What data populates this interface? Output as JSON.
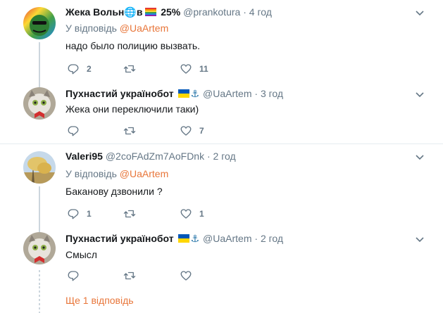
{
  "tweets": [
    {
      "name": "Жека Вольн",
      "name_suffix": "в",
      "name_extra": "25%",
      "handle": "@prankotura",
      "time": "4 год",
      "reply_prefix": "У відповідь",
      "reply_mention": "@UaArtem",
      "text": "надо было полицию вызвать.",
      "replies": "2",
      "retweets": "",
      "likes": "11"
    },
    {
      "name": "Пухнастий українобот",
      "handle": "@UaArtem",
      "time": "3 год",
      "text": "Жека они переключили таки)",
      "replies": "",
      "retweets": "",
      "likes": "7"
    },
    {
      "name": "Valeri95",
      "handle": "@2coFAdZm7AoFDnk",
      "time": "2 год",
      "reply_prefix": "У відповідь",
      "reply_mention": "@UaArtem",
      "text": "Баканову дзвонили ?",
      "replies": "1",
      "retweets": "",
      "likes": "1"
    },
    {
      "name": "Пухнастий українобот",
      "handle": "@UaArtem",
      "time": "2 год",
      "text": "Смысл",
      "replies": "",
      "retweets": "",
      "likes": ""
    }
  ],
  "dot": "·",
  "show_more": "Ще 1 відповідь",
  "icons": {
    "reply": "reply-icon",
    "retweet": "retweet-icon",
    "like": "heart-icon",
    "more": "chevron-down-icon",
    "flag": "ukraine-flag-icon",
    "anchor": "anchor-icon",
    "globe": "globe-icon",
    "rainbow": "rainbow-flag-icon"
  },
  "colors": {
    "mention": "#e8763a",
    "secondary_text": "#657786",
    "divider": "#e6ecf0"
  }
}
